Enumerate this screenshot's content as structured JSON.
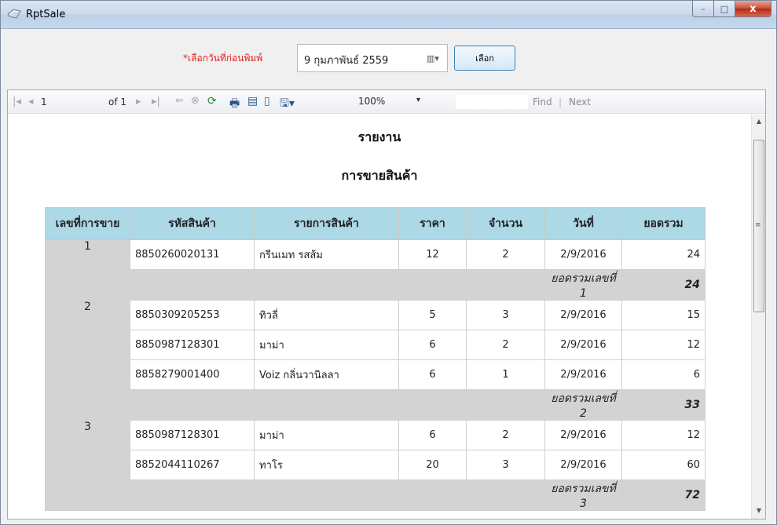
{
  "window": {
    "title": "RptSale",
    "minimize": "–",
    "maximize": "□",
    "close": "x"
  },
  "filter": {
    "prompt": "*เลือกวันที่ก่อนพิมพ์",
    "date_value": "9 กุมภาพันธ์  2559",
    "calendar_icon": "▥▾",
    "select_label": "เลือก"
  },
  "toolbar": {
    "first": "|◂",
    "prev": "◂",
    "page": "1",
    "of_label": "of 1",
    "next": "▸",
    "last": "▸|",
    "back": "⇐",
    "stop": "⊗",
    "refresh": "⟳",
    "print": "🖶",
    "print_layout": "▤",
    "page_setup": "▯",
    "export": "🖫▾",
    "zoom": "100%",
    "zoom_arrow": "▾",
    "find_label": "Find",
    "separator": "|",
    "next_label": "Next"
  },
  "report": {
    "title": "รายงาน",
    "subtitle": "การขายสินค้า",
    "columns": [
      "เลขที่การขาย",
      "รหัสสินค้า",
      "รายการสินค้า",
      "ราคา",
      "จำนวน",
      "วันที่",
      "ยอดรวม"
    ],
    "groups": [
      {
        "id": "1",
        "rows": [
          {
            "code": "8850260020131",
            "name": "กรีนเมท รสส้ม",
            "price": "12",
            "qty": "2",
            "date": "2/9/2016",
            "total": "24"
          }
        ],
        "subtotal_label": "ยอดรวมเลขที่ 1",
        "subtotal": "24"
      },
      {
        "id": "2",
        "rows": [
          {
            "code": "8850309205253",
            "name": "ทิวลี่",
            "price": "5",
            "qty": "3",
            "date": "2/9/2016",
            "total": "15"
          },
          {
            "code": "8850987128301",
            "name": "มาม่า",
            "price": "6",
            "qty": "2",
            "date": "2/9/2016",
            "total": "12"
          },
          {
            "code": "8858279001400",
            "name": "Voiz กลิ่นวานิลลา",
            "price": "6",
            "qty": "1",
            "date": "2/9/2016",
            "total": "6"
          }
        ],
        "subtotal_label": "ยอดรวมเลขที่ 2",
        "subtotal": "33"
      },
      {
        "id": "3",
        "rows": [
          {
            "code": "8850987128301",
            "name": "มาม่า",
            "price": "6",
            "qty": "2",
            "date": "2/9/2016",
            "total": "12"
          },
          {
            "code": "8852044110267",
            "name": "ทาโร",
            "price": "20",
            "qty": "3",
            "date": "2/9/2016",
            "total": "60"
          }
        ],
        "subtotal_label": "ยอดรวมเลขที่ 3",
        "subtotal": "72"
      }
    ]
  },
  "scrollbar": {
    "up": "▲",
    "down": "▼",
    "grip": "≡"
  },
  "colors": {
    "header_bg": "#add8e6",
    "group_bg": "#d3d3d3",
    "prompt": "#e0201a"
  }
}
